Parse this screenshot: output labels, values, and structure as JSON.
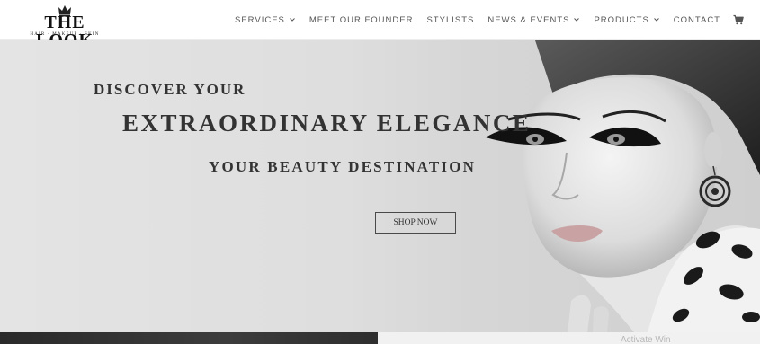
{
  "brand": {
    "name": "THE LOOK",
    "tagline": "HAIR · MAKEUP · SKIN"
  },
  "nav": {
    "items": [
      {
        "label": "SERVICES",
        "has_dropdown": true
      },
      {
        "label": "MEET OUR FOUNDER",
        "has_dropdown": false
      },
      {
        "label": "STYLISTS",
        "has_dropdown": false
      },
      {
        "label": "NEWS & EVENTS",
        "has_dropdown": true
      },
      {
        "label": "PRODUCTS",
        "has_dropdown": true
      },
      {
        "label": "CONTACT",
        "has_dropdown": false
      }
    ],
    "cart_icon": "cart-icon"
  },
  "hero": {
    "line1": "DISCOVER YOUR",
    "line2": "EXTRAORDINARY ELEGANCE",
    "line3": "YOUR BEAUTY DESTINATION",
    "cta_label": "SHOP NOW"
  },
  "watermark": "Activate Win",
  "colors": {
    "text_dark": "#333333",
    "nav_text": "#555555",
    "hero_bg": "#dedede"
  }
}
